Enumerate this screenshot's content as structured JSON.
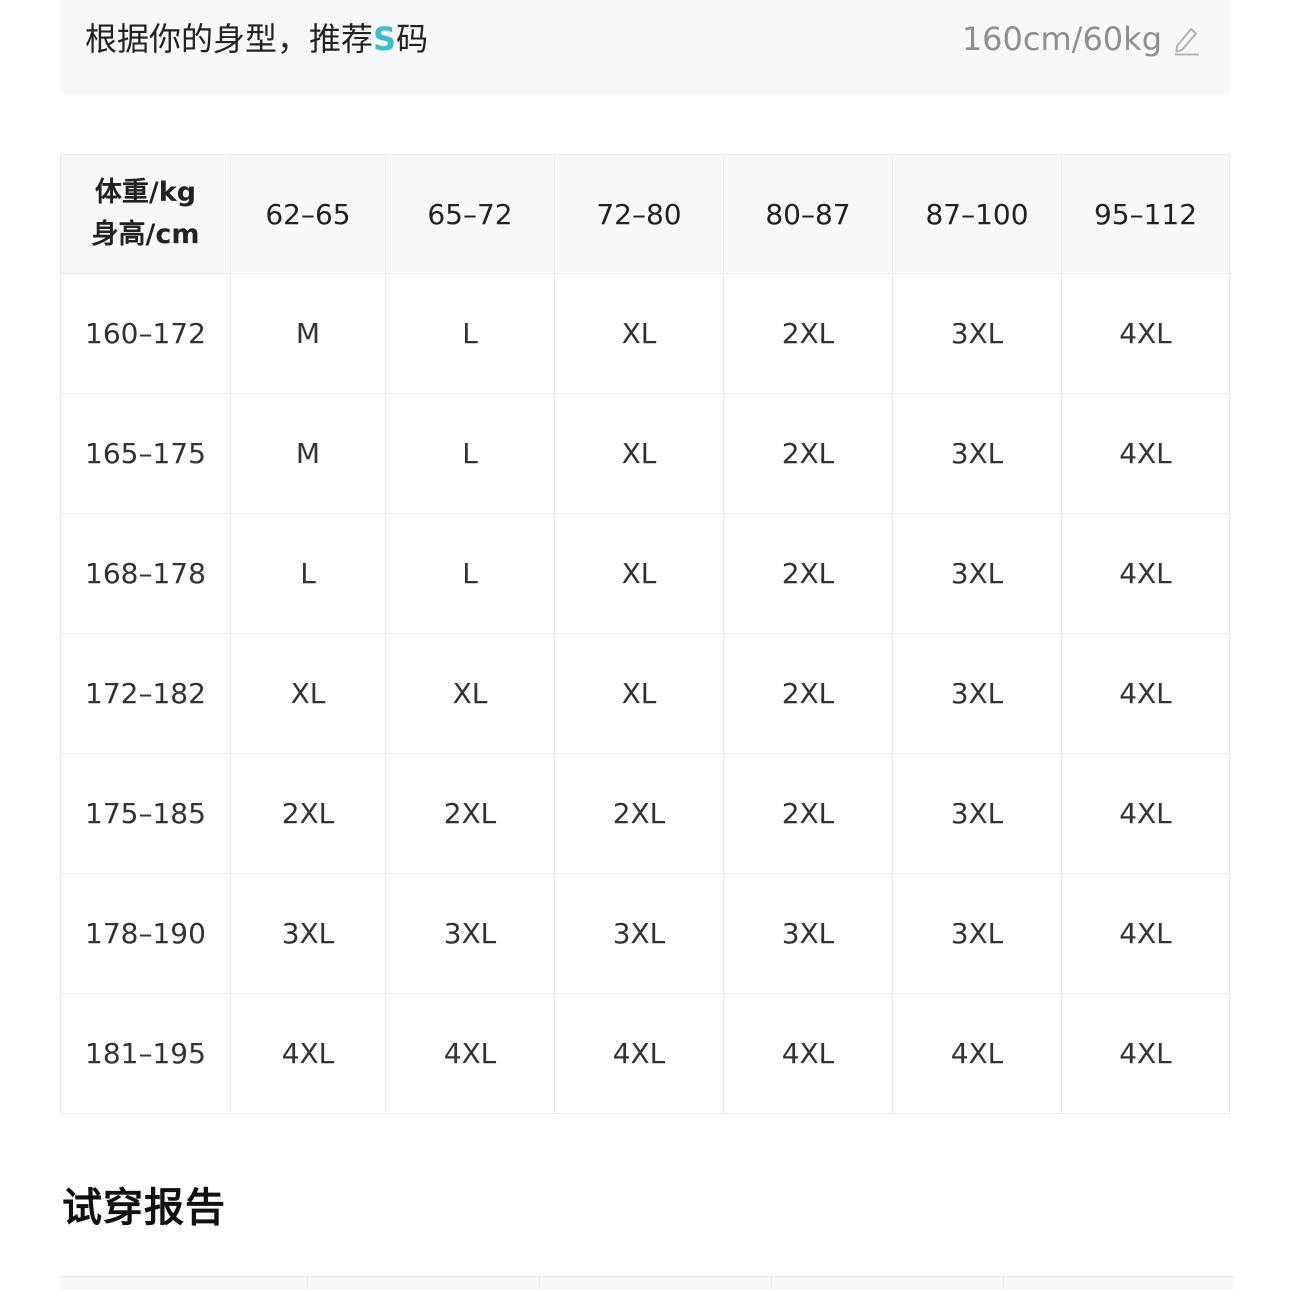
{
  "recommendation": {
    "prefix": "根据你的身型，推荐",
    "size": "S",
    "suffix": "码",
    "measurements": "160cm/60kg",
    "edit_icon": "edit-pencil-icon",
    "accent_color": "#3dbdc6"
  },
  "size_table": {
    "corner_weight": "体重/kg",
    "corner_height": "身高/cm",
    "weight_ranges": [
      "62–65",
      "65–72",
      "72–80",
      "80–87",
      "87–100",
      "95–112"
    ],
    "rows": [
      {
        "height": "160–172",
        "sizes": [
          "M",
          "L",
          "XL",
          "2XL",
          "3XL",
          "4XL"
        ]
      },
      {
        "height": "165–175",
        "sizes": [
          "M",
          "L",
          "XL",
          "2XL",
          "3XL",
          "4XL"
        ]
      },
      {
        "height": "168–178",
        "sizes": [
          "L",
          "L",
          "XL",
          "2XL",
          "3XL",
          "4XL"
        ]
      },
      {
        "height": "172–182",
        "sizes": [
          "XL",
          "XL",
          "XL",
          "2XL",
          "3XL",
          "4XL"
        ]
      },
      {
        "height": "175–185",
        "sizes": [
          "2XL",
          "2XL",
          "2XL",
          "2XL",
          "3XL",
          "4XL"
        ]
      },
      {
        "height": "178–190",
        "sizes": [
          "3XL",
          "3XL",
          "3XL",
          "3XL",
          "3XL",
          "4XL"
        ]
      },
      {
        "height": "181–195",
        "sizes": [
          "4XL",
          "4XL",
          "4XL",
          "4XL",
          "4XL",
          "4XL"
        ]
      }
    ]
  },
  "report": {
    "title": "试穿报告"
  }
}
